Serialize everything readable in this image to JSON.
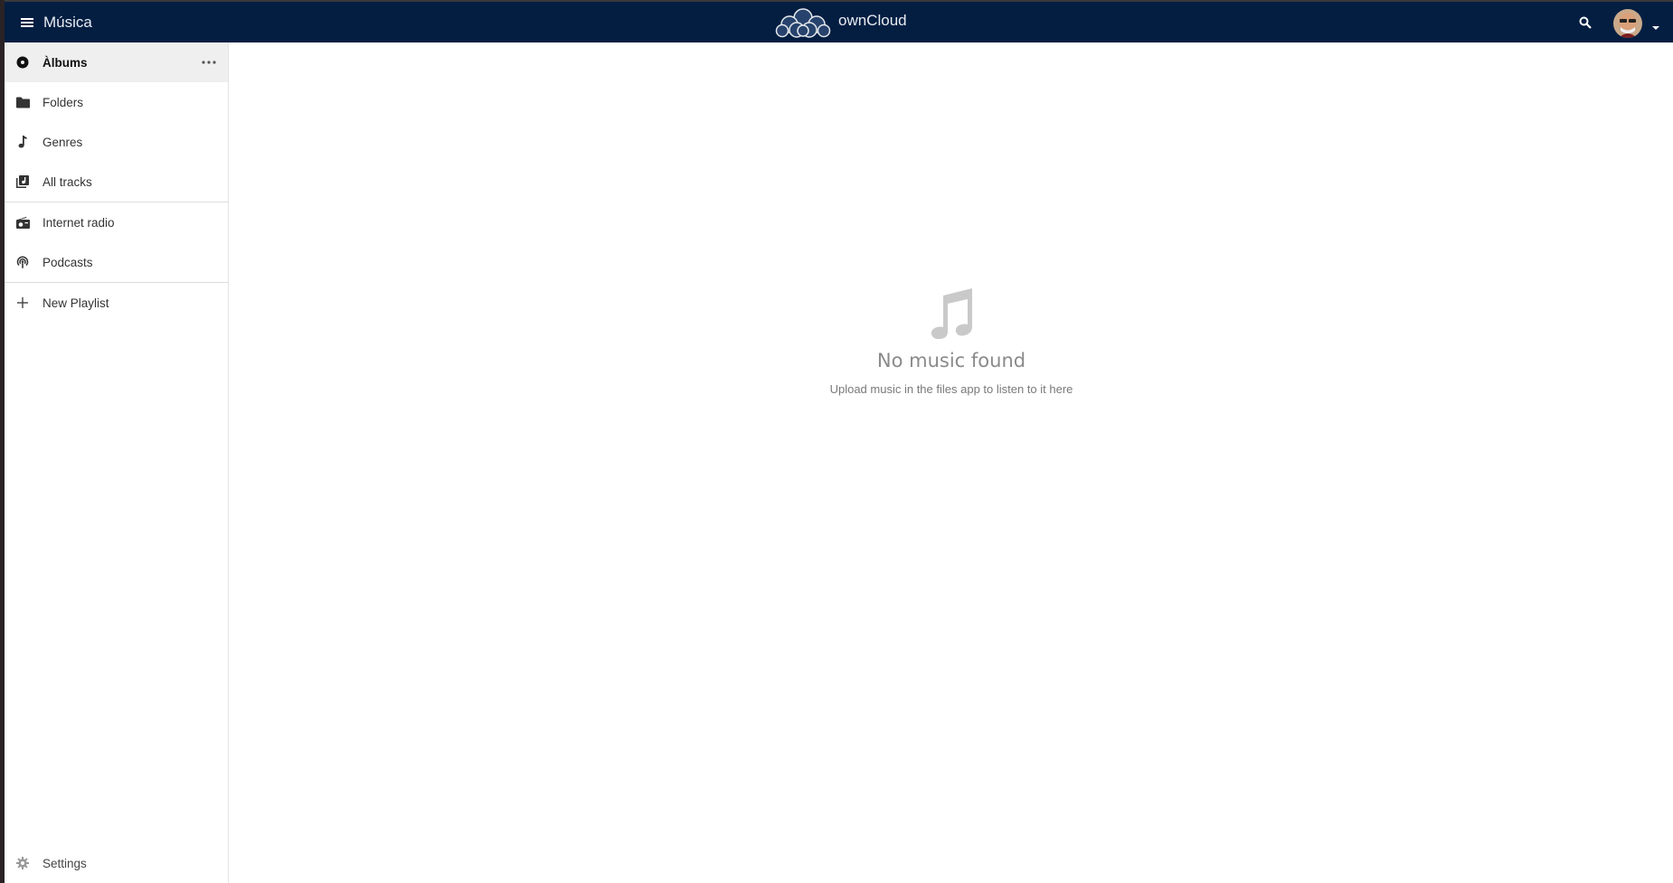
{
  "header": {
    "app_title": "Música",
    "brand": "ownCloud",
    "bg_color": "#041e42"
  },
  "sidebar": {
    "items": [
      {
        "label": "Àlbums",
        "icon": "album-icon",
        "active": true
      },
      {
        "label": "Folders",
        "icon": "folder-icon"
      },
      {
        "label": "Genres",
        "icon": "music-note-icon"
      },
      {
        "label": "All tracks",
        "icon": "library-icon"
      },
      {
        "label": "Internet radio",
        "icon": "radio-icon"
      },
      {
        "label": "Podcasts",
        "icon": "podcast-icon"
      },
      {
        "label": "New Playlist",
        "icon": "plus-icon"
      }
    ],
    "settings_label": "Settings"
  },
  "main": {
    "empty_icon": "music-note-icon",
    "empty_title": "No music found",
    "empty_subtitle": "Upload music in the files app to listen to it here"
  }
}
